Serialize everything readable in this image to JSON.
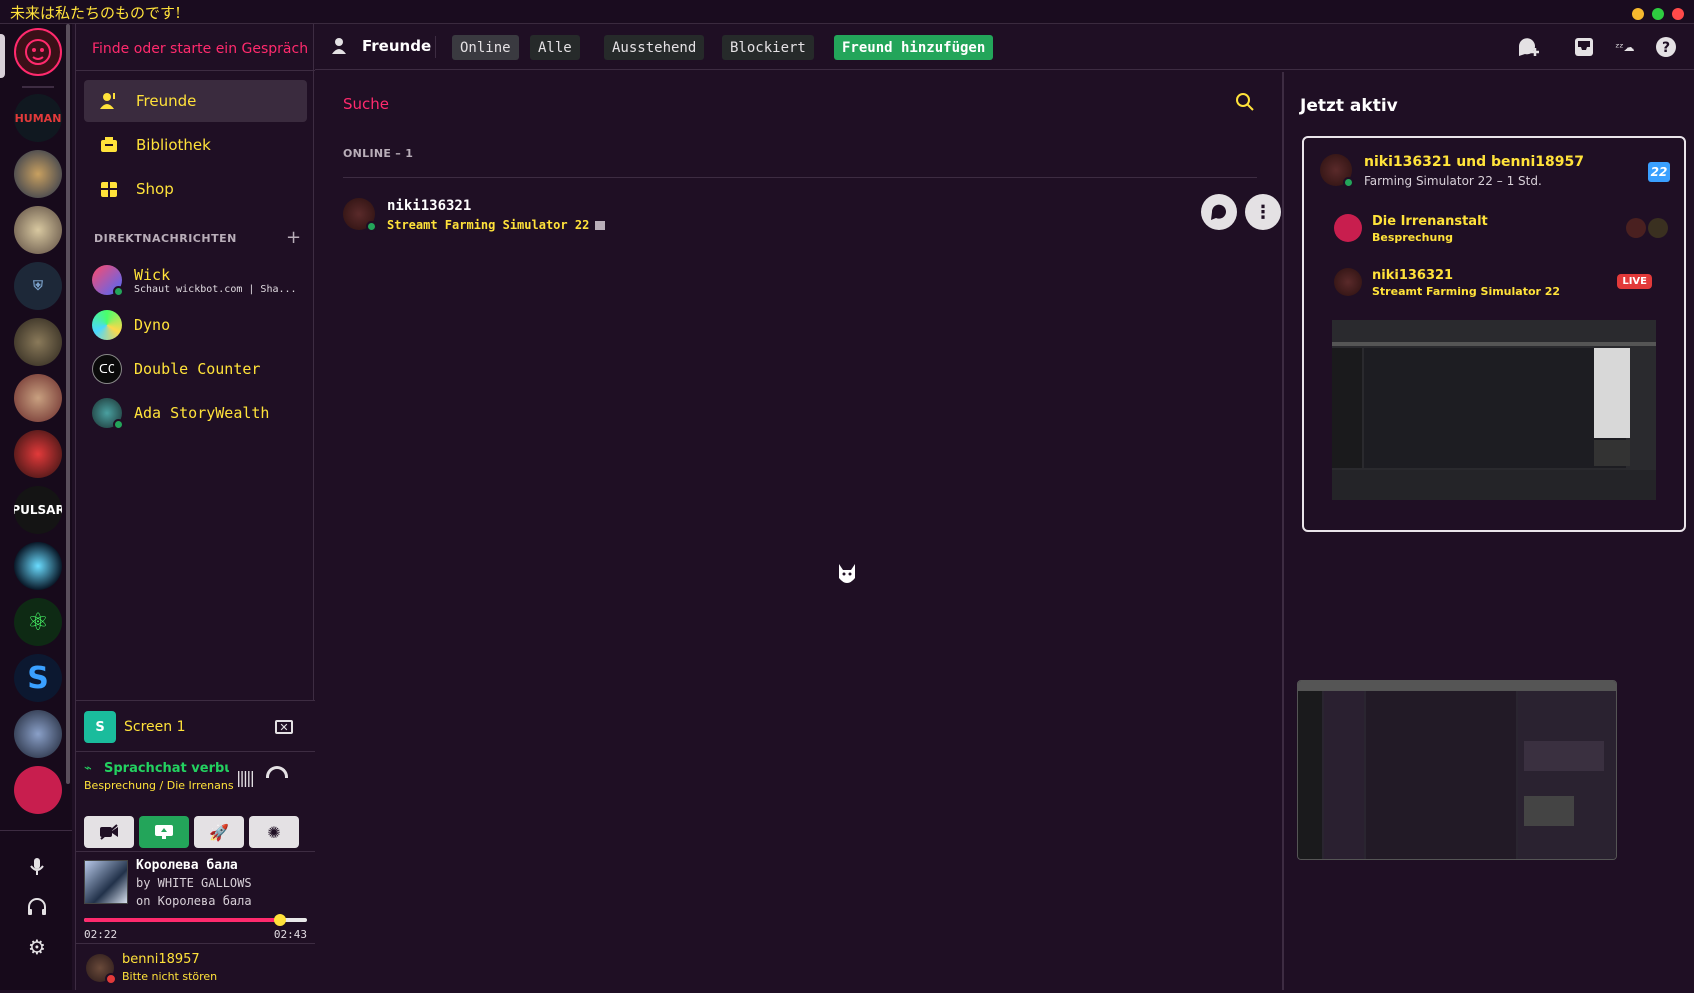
{
  "titlebar": {
    "title": "未来は私たちのものです!",
    "controls": [
      "minimize",
      "maximize",
      "close"
    ]
  },
  "servers": [
    {
      "name": "home-avatar",
      "color": "#3a1018"
    },
    {
      "name": "once-human",
      "label": "HUMAN",
      "color": "#101820"
    },
    {
      "name": "wings-emblem",
      "color": "#23304a"
    },
    {
      "name": "crest",
      "color": "#5a4a40"
    },
    {
      "name": "shield",
      "color": "#1d2838"
    },
    {
      "name": "soldier",
      "color": "#4a4438"
    },
    {
      "name": "santa",
      "color": "#6a2a2a"
    },
    {
      "name": "red-mask",
      "color": "#2a1010"
    },
    {
      "name": "pulsar",
      "label": "PULSAR",
      "color": "#141414"
    },
    {
      "name": "planet",
      "color": "#0a1a2a"
    },
    {
      "name": "atom",
      "color": "#0e2a14"
    },
    {
      "name": "s-logo",
      "label": "S",
      "color": "#0c1830"
    },
    {
      "name": "star-trek",
      "color": "#1a2030"
    },
    {
      "name": "red-server",
      "color": "#c81e4e"
    }
  ],
  "sidebar": {
    "find_placeholder": "Finde oder starte ein Gespräch",
    "nav": [
      {
        "label": "Freunde",
        "icon": "friends-icon"
      },
      {
        "label": "Bibliothek",
        "icon": "library-icon"
      },
      {
        "label": "Shop",
        "icon": "shop-icon"
      }
    ],
    "dm_header": "DIREKTNACHRICHTEN",
    "dms": [
      {
        "name": "Wick",
        "sub": "Schaut wickbot.com | Sha..."
      },
      {
        "name": "Dyno",
        "sub": ""
      },
      {
        "name": "Double Counter",
        "sub": ""
      },
      {
        "name": "Ada StoryWealth",
        "sub": ""
      }
    ]
  },
  "stream": {
    "label": "Screen 1",
    "avatar_letter": "S"
  },
  "voice": {
    "status": "Sprachchat verbunden",
    "channel": "Besprechung / Die Irrenans..."
  },
  "music": {
    "title": "Королева бала",
    "by": "by WHITE GALLOWS",
    "on": "on Королева бала",
    "elapsed": "02:22",
    "total": "02:43",
    "progress": 0.88
  },
  "user": {
    "name": "benni18957",
    "status": "Bitte nicht stören"
  },
  "toolbar": {
    "title": "Freunde",
    "tabs": [
      "Online",
      "Alle",
      "Ausstehend",
      "Blockiert"
    ],
    "add_friend": "Freund hinzufügen"
  },
  "friends": {
    "search_placeholder": "Suche",
    "online_header": "ONLINE – 1",
    "list": [
      {
        "name": "niki136321",
        "activity": "Streamt Farming Simulator 22"
      }
    ]
  },
  "active_now": {
    "title": "Jetzt aktiv",
    "header_name": "niki136321 und benni18957",
    "header_game": "Farming Simulator 22 – 1 Std.",
    "game_badge": "22",
    "rows": [
      {
        "name": "Die Irrenanstalt",
        "sub": "Besprechung"
      },
      {
        "name": "niki136321",
        "sub": "Streamt Farming Simulator 22",
        "badge": "LIVE"
      }
    ]
  },
  "colors": {
    "accent_yellow": "#ffe23a",
    "accent_pink": "#ff2a6d",
    "bg": "#1f0f24",
    "online": "#23a55a"
  }
}
